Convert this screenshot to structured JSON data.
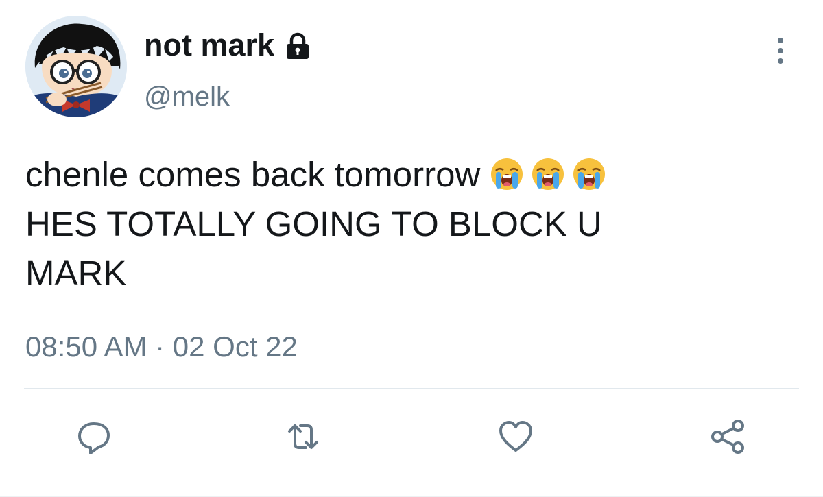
{
  "tweet": {
    "author": {
      "display_name": "not mark",
      "handle": "@melk",
      "protected_icon": "lock-icon",
      "avatar_icon": "anime-avatar"
    },
    "text_lines": [
      "chenle comes back tomorrow",
      "HES TOTALLY GOING TO BLOCK U",
      "MARK"
    ],
    "emojis": [
      "loudly-crying-face",
      "loudly-crying-face",
      "loudly-crying-face"
    ],
    "timestamp": "08:50 AM · 02 Oct 22"
  },
  "actions": [
    {
      "name": "reply",
      "icon": "reply-icon"
    },
    {
      "name": "retweet",
      "icon": "retweet-icon"
    },
    {
      "name": "like",
      "icon": "heart-icon"
    },
    {
      "name": "share",
      "icon": "share-icon"
    }
  ],
  "colors": {
    "text": "#14171a",
    "secondary": "#657786",
    "divider": "#e1e8ed",
    "icon": "#657786"
  }
}
